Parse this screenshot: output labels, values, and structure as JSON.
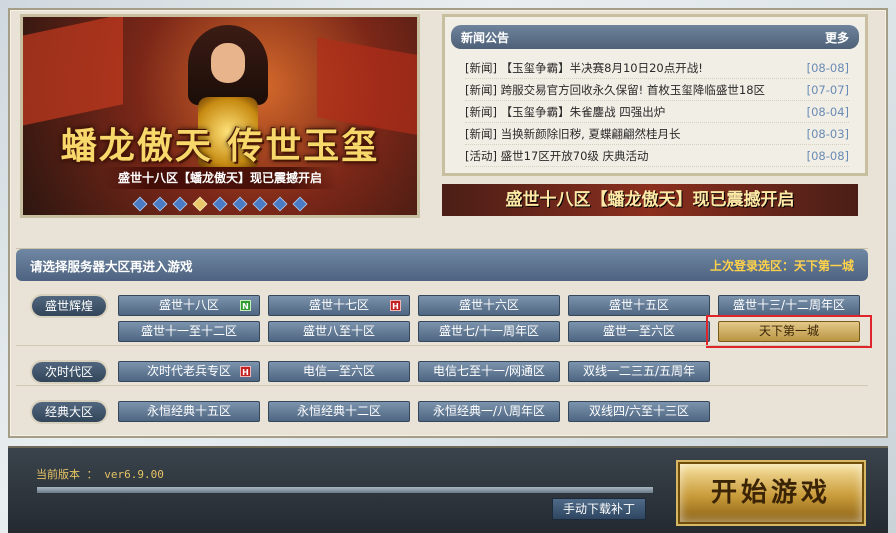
{
  "banner": {
    "title": "蟠龙傲天 传世玉玺",
    "subtitle": "盛世十八区【蟠龙傲天】现已震撼开启",
    "slide_count": 9,
    "active_slide": 3
  },
  "news": {
    "heading": "新闻公告",
    "more_label": "更多",
    "items": [
      {
        "text": "[新闻] 【玉玺争霸】半决赛8月10日20点开战!",
        "date": "[08-08]"
      },
      {
        "text": "[新闻] 跨服交易官方回收永久保留! 首枚玉玺降临盛世18区",
        "date": "[07-07]"
      },
      {
        "text": "[新闻] 【玉玺争霸】朱雀鏖战 四强出炉",
        "date": "[08-04]"
      },
      {
        "text": "[新闻] 当换新颜除旧秽, 夏蝶翩翩然桂月长",
        "date": "[08-03]"
      },
      {
        "text": "[活动] 盛世17区开放70级 庆典活动",
        "date": "[08-08]"
      }
    ],
    "promo": "盛世十八区【蟠龙傲天】现已震撼开启"
  },
  "server": {
    "hint": "请选择服务器大区再进入游戏",
    "last_label": "上次登录选区：",
    "last_value": "天下第一城",
    "groups": [
      {
        "label": "盛世辉煌",
        "rows": [
          [
            {
              "name": "盛世十八区",
              "tag": "N"
            },
            {
              "name": "盛世十七区",
              "tag": "H"
            },
            {
              "name": "盛世十六区"
            },
            {
              "name": "盛世十五区"
            },
            {
              "name": "盛世十三/十二周年区"
            }
          ],
          [
            {
              "name": "盛世十一至十二区"
            },
            {
              "name": "盛世八至十区"
            },
            {
              "name": "盛世七/十一周年区"
            },
            {
              "name": "盛世一至六区"
            },
            {
              "name": "天下第一城",
              "selected": true
            }
          ]
        ]
      },
      {
        "label": "次时代区",
        "rows": [
          [
            {
              "name": "次时代老兵专区",
              "tag": "H"
            },
            {
              "name": "电信一至六区"
            },
            {
              "name": "电信七至十一/网通区"
            },
            {
              "name": "双线一二三五/五周年"
            }
          ]
        ]
      },
      {
        "label": "经典大区",
        "rows": [
          [
            {
              "name": "永恒经典十五区"
            },
            {
              "name": "永恒经典十二区"
            },
            {
              "name": "永恒经典一/八周年区"
            },
            {
              "name": "双线四/六至十三区"
            }
          ]
        ]
      }
    ]
  },
  "footer": {
    "version": "当前版本 ： ver6.9.00",
    "progress": 1.0,
    "patch_label": "手动下载补丁",
    "start_label": "开始游戏"
  }
}
